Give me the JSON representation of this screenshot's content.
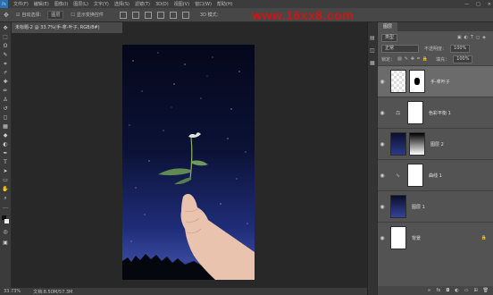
{
  "menu": {
    "logo": "Ps",
    "items": [
      "文件(F)",
      "编辑(E)",
      "图像(I)",
      "图层(L)",
      "文字(Y)",
      "选择(S)",
      "滤镜(T)",
      "3D(D)",
      "视图(V)",
      "窗口(W)",
      "帮助(H)"
    ],
    "window_controls": [
      "—",
      "□",
      "✕"
    ]
  },
  "options": {
    "auto_select_label": "自动选择：",
    "auto_select_value": "图层",
    "transform_label": "显示变换控件",
    "mode_3d": "3D 模式："
  },
  "watermark": "www.16xx8.com",
  "document": {
    "tab_title": "未标题-2 @ 33.7%(手-拿-叶子, RGB/8#)"
  },
  "status": {
    "zoom": "33.73%",
    "doc_info": "文档:8.50M/57.3M"
  },
  "layers_panel": {
    "tab": "图层",
    "kind_label": "类型",
    "blend_mode": "正常",
    "opacity_label": "不透明度：",
    "opacity": "100%",
    "lock_label": "锁定：",
    "fill_label": "填充：",
    "fill": "100%",
    "layers": [
      {
        "name": "手-拿叶子",
        "selected": true
      },
      {
        "name": "色彩平衡 1",
        "selected": false
      },
      {
        "name": "图层 2",
        "selected": false
      },
      {
        "name": "曲线 1",
        "selected": false
      },
      {
        "name": "图层 1",
        "selected": false
      },
      {
        "name": "背景",
        "selected": false
      }
    ],
    "bottom_icons": [
      "link-icon",
      "fx-icon",
      "mask-icon",
      "adjust-icon",
      "folder-icon",
      "new-layer-icon",
      "trash-icon"
    ]
  },
  "colors": {
    "accent": "#2b6fb0",
    "watermark": "#d01414",
    "panel_bg": "#535353"
  }
}
